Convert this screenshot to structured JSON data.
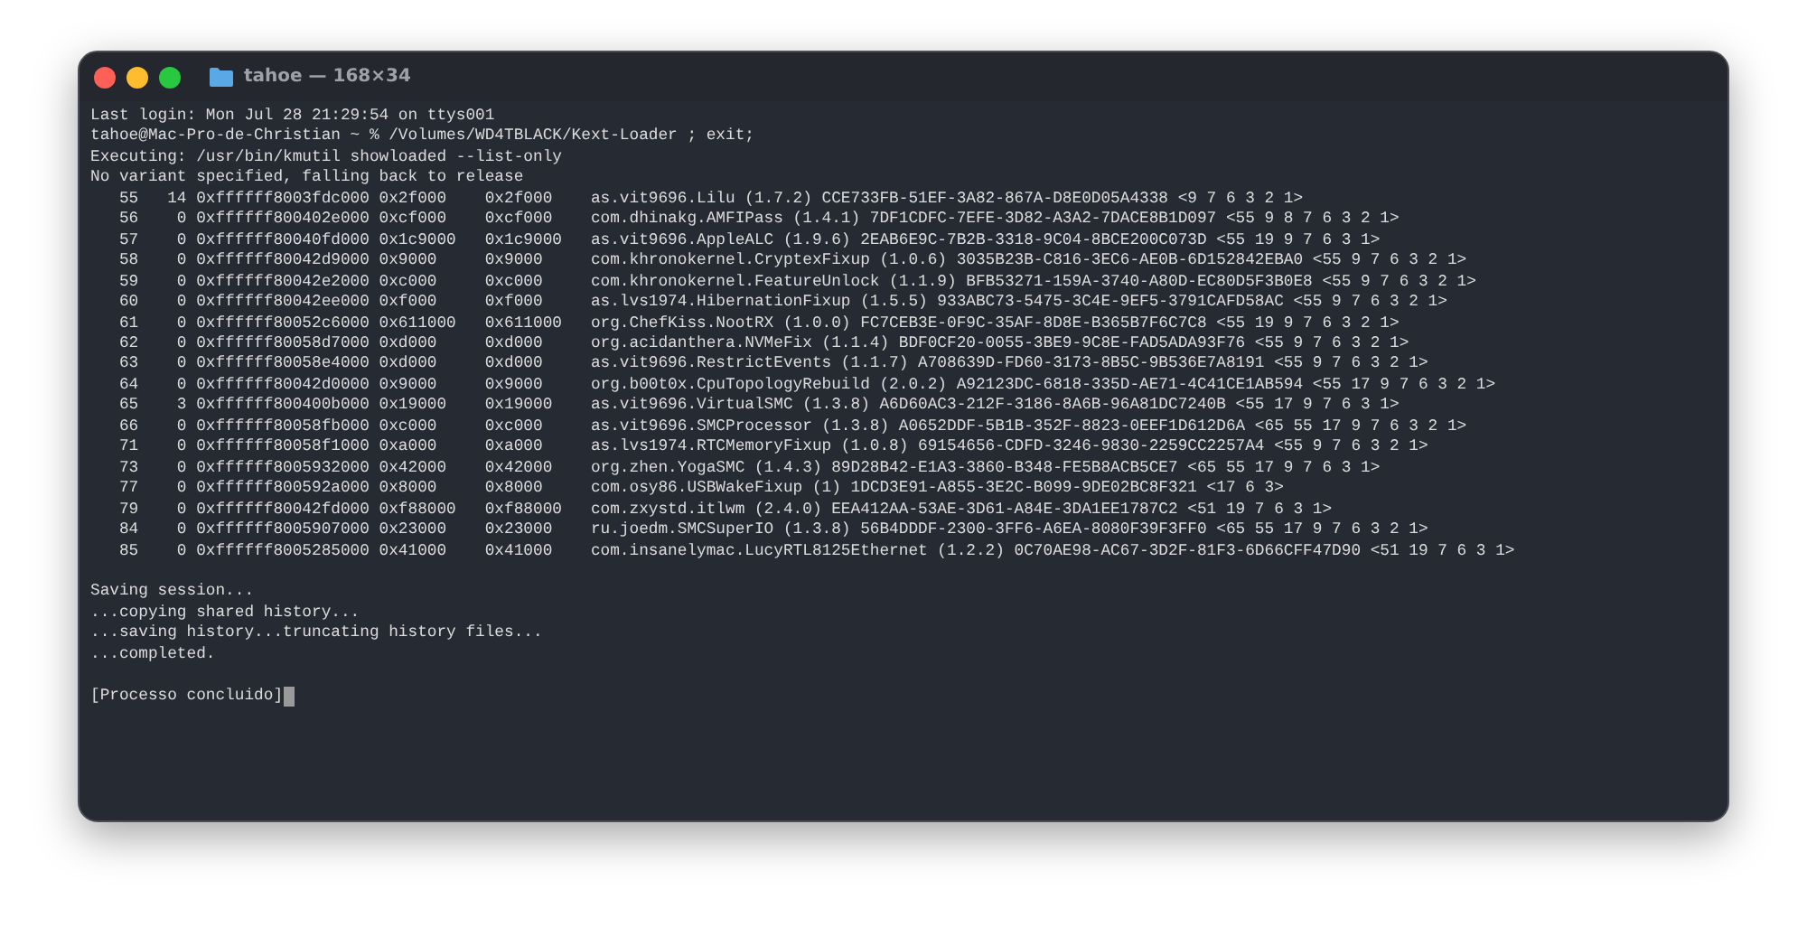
{
  "window": {
    "title": "tahoe — 168×34"
  },
  "terminal": {
    "sections": [
      {
        "lines": [
          "Last login: Mon Jul 28 21:29:54 on ttys001",
          "tahoe@Mac-Pro-de-Christian ~ % /Volumes/WD4TBLACK/Kext-Loader ; exit;",
          "Executing: /usr/bin/kmutil showloaded --list-only",
          "No variant specified, falling back to release",
          "   55   14 0xffffff8003fdc000 0x2f000    0x2f000    as.vit9696.Lilu (1.7.2) CCE733FB-51EF-3A82-867A-D8E0D05A4338 <9 7 6 3 2 1>",
          "   56    0 0xffffff800402e000 0xcf000    0xcf000    com.dhinakg.AMFIPass (1.4.1) 7DF1CDFC-7EFE-3D82-A3A2-7DACE8B1D097 <55 9 8 7 6 3 2 1>",
          "   57    0 0xffffff80040fd000 0x1c9000   0x1c9000   as.vit9696.AppleALC (1.9.6) 2EAB6E9C-7B2B-3318-9C04-8BCE200C073D <55 19 9 7 6 3 1>",
          "   58    0 0xffffff80042d9000 0x9000     0x9000     com.khronokernel.CryptexFixup (1.0.6) 3035B23B-C816-3EC6-AE0B-6D152842EBA0 <55 9 7 6 3 2 1>",
          "   59    0 0xffffff80042e2000 0xc000     0xc000     com.khronokernel.FeatureUnlock (1.1.9) BFB53271-159A-3740-A80D-EC80D5F3B0E8 <55 9 7 6 3 2 1>",
          "   60    0 0xffffff80042ee000 0xf000     0xf000     as.lvs1974.HibernationFixup (1.5.5) 933ABC73-5475-3C4E-9EF5-3791CAFD58AC <55 9 7 6 3 2 1>",
          "   61    0 0xffffff80052c6000 0x611000   0x611000   org.ChefKiss.NootRX (1.0.0) FC7CEB3E-0F9C-35AF-8D8E-B365B7F6C7C8 <55 19 9 7 6 3 2 1>",
          "   62    0 0xffffff80058d7000 0xd000     0xd000     org.acidanthera.NVMeFix (1.1.4) BDF0CF20-0055-3BE9-9C8E-FAD5ADA93F76 <55 9 7 6 3 2 1>",
          "   63    0 0xffffff80058e4000 0xd000     0xd000     as.vit9696.RestrictEvents (1.1.7) A708639D-FD60-3173-8B5C-9B536E7A8191 <55 9 7 6 3 2 1>",
          "   64    0 0xffffff80042d0000 0x9000     0x9000     org.b00t0x.CpuTopologyRebuild (2.0.2) A92123DC-6818-335D-AE71-4C41CE1AB594 <55 17 9 7 6 3 2 1>",
          "   65    3 0xffffff800400b000 0x19000    0x19000    as.vit9696.VirtualSMC (1.3.8) A6D60AC3-212F-3186-8A6B-96A81DC7240B <55 17 9 7 6 3 1>",
          "   66    0 0xffffff80058fb000 0xc000     0xc000     as.vit9696.SMCProcessor (1.3.8) A0652DDF-5B1B-352F-8823-0EEF1D612D6A <65 55 17 9 7 6 3 2 1>",
          "   71    0 0xffffff80058f1000 0xa000     0xa000     as.lvs1974.RTCMemoryFixup (1.0.8) 69154656-CDFD-3246-9830-2259CC2257A4 <55 9 7 6 3 2 1>",
          "   73    0 0xffffff8005932000 0x42000    0x42000    org.zhen.YogaSMC (1.4.3) 89D28B42-E1A3-3860-B348-FE5B8ACB5CE7 <65 55 17 9 7 6 3 1>",
          "   77    0 0xffffff800592a000 0x8000     0x8000     com.osy86.USBWakeFixup (1) 1DCD3E91-A855-3E2C-B099-9DE02BC8F321 <17 6 3>",
          "   79    0 0xffffff80042fd000 0xf88000   0xf88000   com.zxystd.itlwm (2.4.0) EEA412AA-53AE-3D61-A84E-3DA1EE1787C2 <51 19 7 6 3 1>",
          "   84    0 0xffffff8005907000 0x23000    0x23000    ru.joedm.SMCSuperIO (1.3.8) 56B4DDDF-2300-3FF6-A6EA-8080F39F3FF0 <65 55 17 9 7 6 3 2 1>",
          "   85    0 0xffffff8005285000 0x41000    0x41000    com.insanelymac.LucyRTL8125Ethernet (1.2.2) 0C70AE98-AC67-3D2F-81F3-6D66CFF47D90 <51 19 7 6 3 1>"
        ]
      },
      {
        "lines": [
          "Saving session...",
          "...copying shared history...",
          "...saving history...truncating history files...",
          "...completed."
        ]
      },
      {
        "lines": [
          "[Processo concluido]"
        ]
      }
    ]
  }
}
